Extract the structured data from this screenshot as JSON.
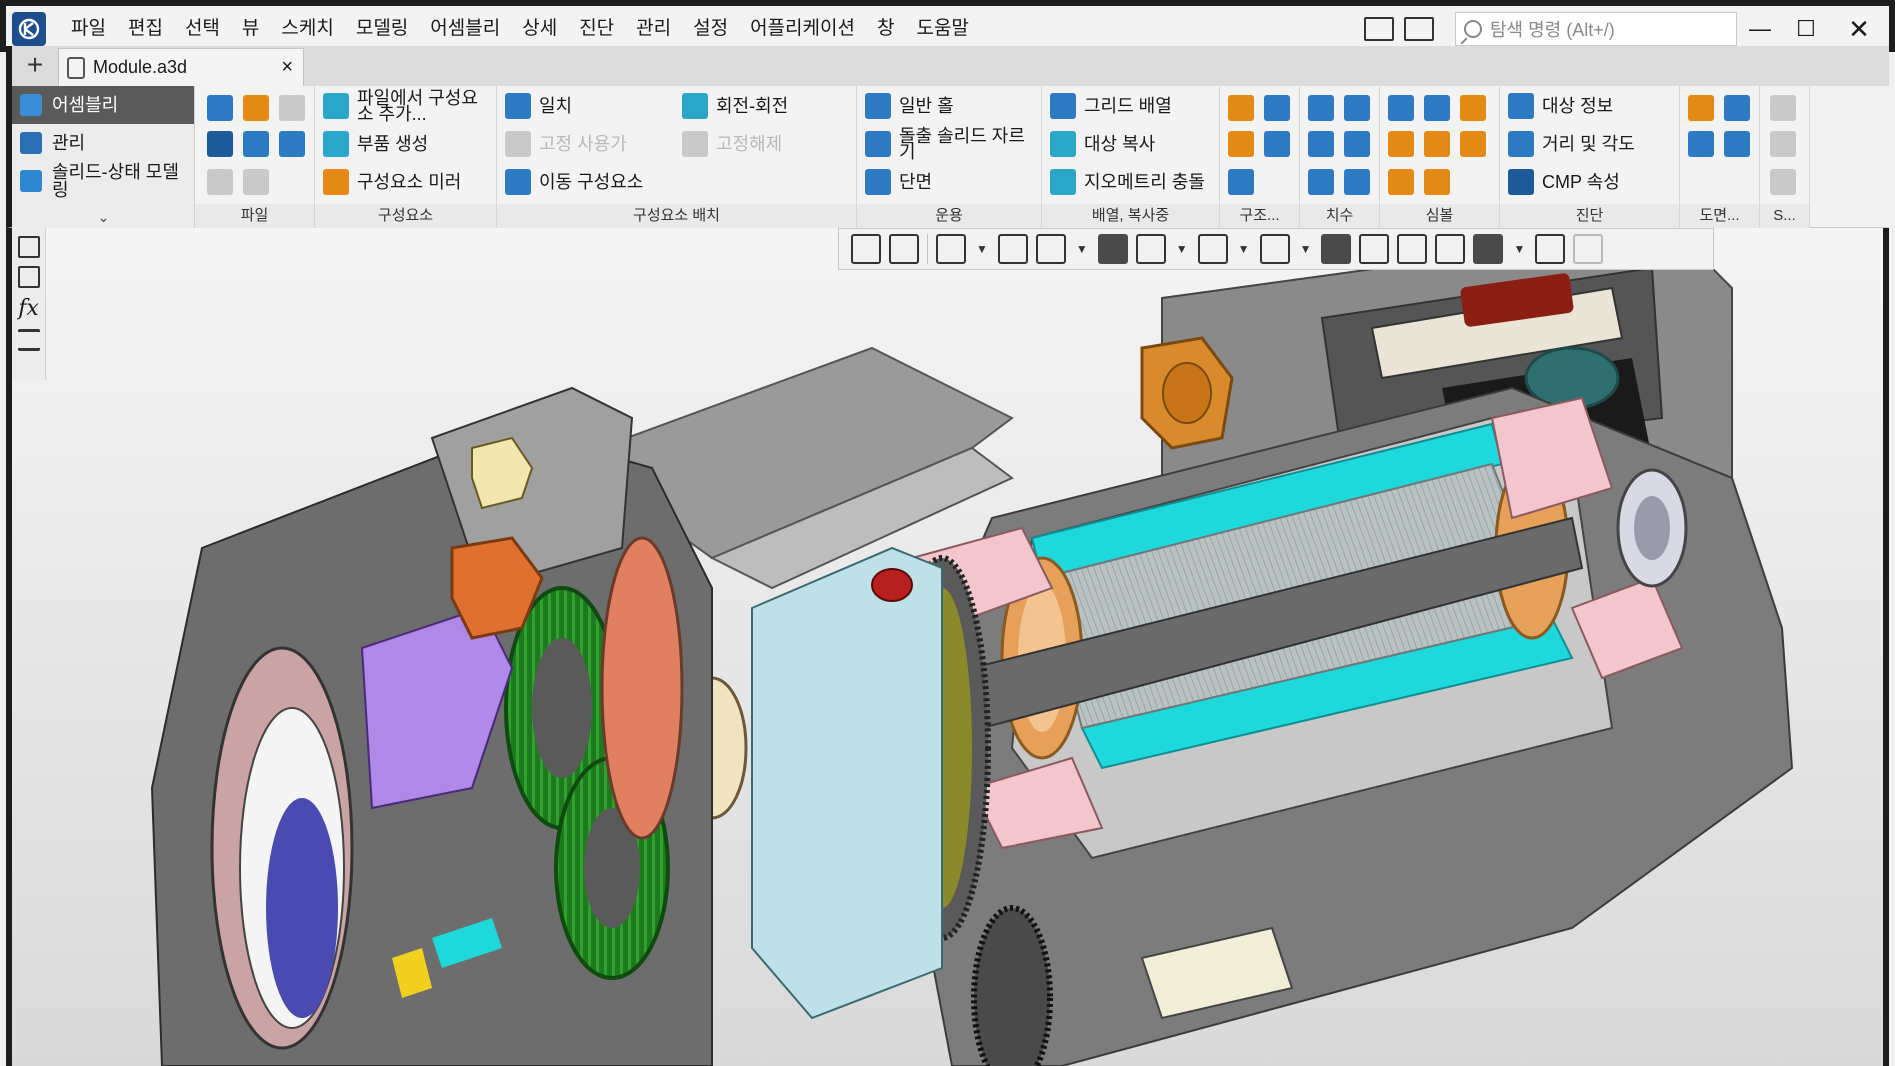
{
  "app": {
    "logo_icon": "kompas-logo-icon",
    "brand_color": "#1f4e8c"
  },
  "menu": {
    "items": [
      "파일",
      "편집",
      "선택",
      "뷰",
      "스케치",
      "모델링",
      "어셈블리",
      "상세",
      "진단",
      "관리",
      "설정",
      "어플리케이션",
      "창",
      "도움말"
    ]
  },
  "search": {
    "placeholder": "탐색 명령 (Alt+/)"
  },
  "document_tab": {
    "title": "Module.a3d",
    "close": "×"
  },
  "new_tab_label": "+",
  "left_nav": {
    "items": [
      {
        "label": "어셈블리",
        "active": true
      },
      {
        "label": "관리",
        "active": false
      },
      {
        "label": "솔리드-상태 모델링",
        "active": false
      }
    ],
    "expand_glyph": "⌄"
  },
  "ribbon": {
    "groups": {
      "file": {
        "label": "파일"
      },
      "components": {
        "label": "구성요소",
        "add_from_file": "파일에서 구성요소 추가...",
        "create_part": "부품 생성",
        "mirror": "구성요소 미러"
      },
      "placement": {
        "label": "구성요소 배치",
        "coincide": "일치",
        "rotate_rotate": "회전-회전",
        "fix_use": "고정 사용가",
        "unfix": "고정해제",
        "move_component": "이동 구성요소"
      },
      "operations": {
        "label": "운용",
        "simple_hole": "일반 홀",
        "extrude_cut": "돌출 솔리드 자르기",
        "section": "단면"
      },
      "array_copy": {
        "label": "배열, 복사중",
        "grid_array": "그리드 배열",
        "copy_object": "대상 복사",
        "geometry_collision": "지오메트리 충돌"
      },
      "structure": {
        "label": "구조..."
      },
      "dimensions": {
        "label": "치수"
      },
      "symbols": {
        "label": "심볼"
      },
      "diagnostics": {
        "label": "진단",
        "object_info": "대상 정보",
        "distance_angle": "거리 및 각도",
        "cmp_props": "CMP 속성"
      },
      "drawing": {
        "label": "도면..."
      },
      "s": {
        "label": "S..."
      }
    }
  },
  "scene": {
    "cyan_accent": "#1fd8dc",
    "gear_green": "#1f7a1f",
    "housing_gray": "#8c8c8c"
  }
}
